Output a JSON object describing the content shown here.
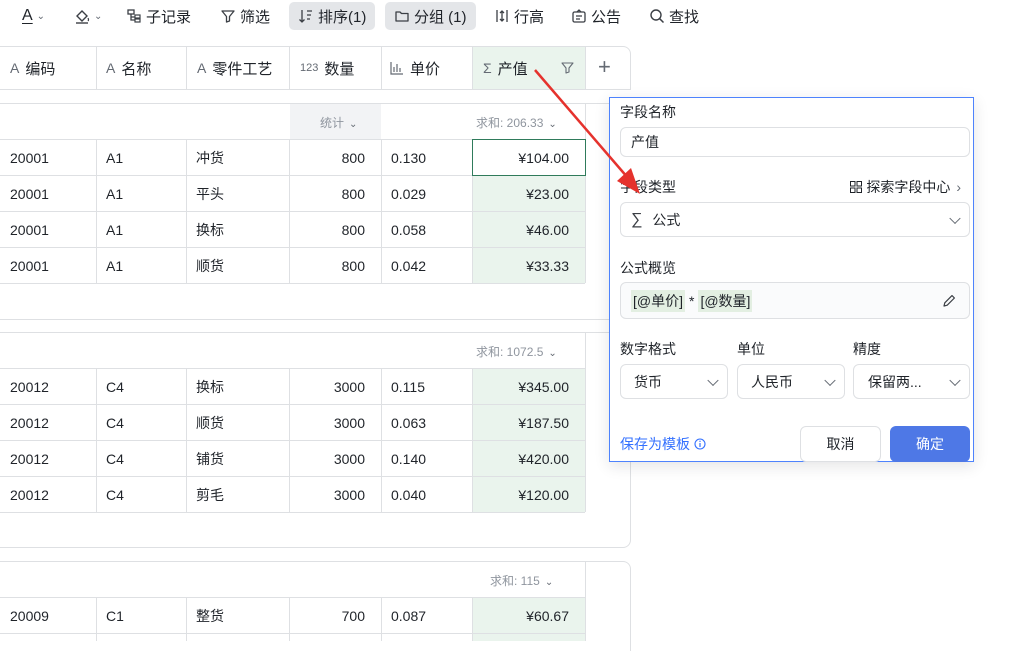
{
  "toolbar": {
    "text_color_icon": "A",
    "fill_color_icon": "paint-bucket",
    "subrecord": "子记录",
    "filter": "筛选",
    "sort": "排序(1)",
    "group": "分组 (1)",
    "row_height": "行高",
    "announcement": "公告",
    "search": "查找"
  },
  "columns": [
    {
      "type_icon": "A",
      "label": "编码"
    },
    {
      "type_icon": "A",
      "label": "名称"
    },
    {
      "type_icon": "A",
      "label": "零件工艺"
    },
    {
      "type_icon": "123",
      "label": "数量"
    },
    {
      "type_icon": "bar-chart",
      "label": "单价"
    },
    {
      "type_icon": "Σ",
      "label": "产值"
    }
  ],
  "stats_label": "统计",
  "groups": [
    {
      "summary": "求和: 206.33",
      "rows": [
        {
          "code": "20001",
          "name": "A1",
          "process": "冲货",
          "qty": "800",
          "price": "0.130",
          "value": "¥104.00"
        },
        {
          "code": "20001",
          "name": "A1",
          "process": "平头",
          "qty": "800",
          "price": "0.029",
          "value": "¥23.00"
        },
        {
          "code": "20001",
          "name": "A1",
          "process": "换标",
          "qty": "800",
          "price": "0.058",
          "value": "¥46.00"
        },
        {
          "code": "20001",
          "name": "A1",
          "process": "顺货",
          "qty": "800",
          "price": "0.042",
          "value": "¥33.33"
        }
      ]
    },
    {
      "summary": "求和: 1072.5",
      "rows": [
        {
          "code": "20012",
          "name": "C4",
          "process": "换标",
          "qty": "3000",
          "price": "0.115",
          "value": "¥345.00"
        },
        {
          "code": "20012",
          "name": "C4",
          "process": "顺货",
          "qty": "3000",
          "price": "0.063",
          "value": "¥187.50"
        },
        {
          "code": "20012",
          "name": "C4",
          "process": "铺货",
          "qty": "3000",
          "price": "0.140",
          "value": "¥420.00"
        },
        {
          "code": "20012",
          "name": "C4",
          "process": "剪毛",
          "qty": "3000",
          "price": "0.040",
          "value": "¥120.00"
        }
      ]
    },
    {
      "summary": "求和: 115",
      "rows": [
        {
          "code": "20009",
          "name": "C1",
          "process": "整货",
          "qty": "700",
          "price": "0.087",
          "value": "¥60.67"
        }
      ]
    }
  ],
  "panel": {
    "field_name_label": "字段名称",
    "field_name_value": "产值",
    "field_type_label": "字段类型",
    "explore_link": "探索字段中心",
    "field_type_value": "公式",
    "formula_label": "公式概览",
    "formula_price": "[@单价]",
    "formula_op": "*",
    "formula_qty": "[@数量]",
    "number_format_label": "数字格式",
    "number_format_value": "货币",
    "unit_label": "单位",
    "unit_value": "人民币",
    "precision_label": "精度",
    "precision_value": "保留两...",
    "save_template": "保存为模板",
    "cancel": "取消",
    "confirm": "确定"
  },
  "colors": {
    "accent": "#3370ff",
    "formula_column_bg": "#eaf4ed",
    "annotation_arrow": "#e5322d"
  }
}
